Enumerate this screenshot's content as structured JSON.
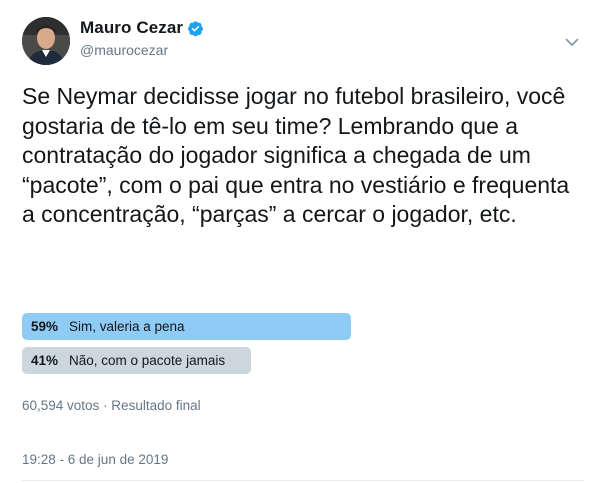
{
  "author": {
    "display_name": "Mauro Cezar",
    "handle": "@maurocezar",
    "verified": true,
    "accent_color": "#1da1f2"
  },
  "tweet": {
    "text": "Se Neymar decidisse jogar no futebol brasileiro, você gostaria de tê-lo em seu time? Lembrando que a contratação do jogador significa a chegada de um “pacote”, com o pai que entra no vestiário e frequenta a concentração, “parças” a cercar o jogador, etc."
  },
  "poll": {
    "options": [
      {
        "percent_label": "59%",
        "percent": 59,
        "label": "Sim, valeria a pena",
        "winner": true
      },
      {
        "percent_label": "41%",
        "percent": 41,
        "label": "Não, com o pacote jamais",
        "winner": false
      }
    ],
    "meta": "60,594 votos · Resultado final"
  },
  "timestamp": "19:28 - 6 de jun de 2019",
  "icons": {
    "verified": "verified-badge-icon",
    "menu": "chevron-down-icon"
  },
  "colors": {
    "winner_bar": "#8ecbf5",
    "loser_bar": "#ccd6dd",
    "secondary_text": "#657786"
  }
}
